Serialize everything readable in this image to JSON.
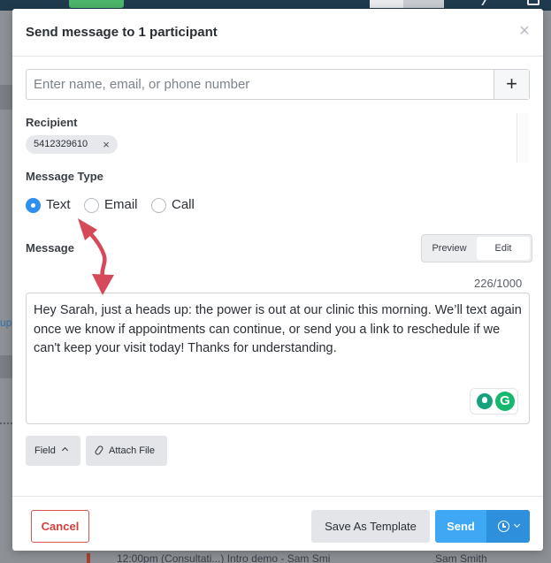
{
  "modal": {
    "title": "Send message to 1 participant",
    "close_glyph": "×"
  },
  "search": {
    "placeholder": "Enter name, email, or phone number",
    "value": "",
    "add_glyph": "+"
  },
  "recipient": {
    "label": "Recipient",
    "chips": [
      {
        "value": "5412329610",
        "remove_glyph": "×"
      }
    ]
  },
  "message_type": {
    "label": "Message Type",
    "options": [
      {
        "label": "Text",
        "checked": true
      },
      {
        "label": "Email",
        "checked": false
      },
      {
        "label": "Call",
        "checked": false
      }
    ]
  },
  "message": {
    "label": "Message",
    "mode_tabs": [
      {
        "label": "Preview",
        "active": false
      },
      {
        "label": "Edit",
        "active": true
      }
    ],
    "char_count": "226/1000",
    "body": "Hey Sarah, just a heads up: the power is out at our clinic this morning. We’ll text again once we know if appointments can continue, or send you a link to reschedule if we can't keep your visit today! Thanks for understanding.",
    "field_button": "Field",
    "attach_button": "Attach File"
  },
  "footer": {
    "cancel": "Cancel",
    "save_template": "Save As Template",
    "send": "Send"
  },
  "icons": {
    "close": "close-icon",
    "add": "plus-icon",
    "chip_remove": "close-icon",
    "field_caret": "chevron-up-icon",
    "attach": "paperclip-icon",
    "schedule": "clock-icon",
    "schedule_caret": "chevron-down-icon",
    "grammar_suggest": "lightbulb-icon",
    "grammarly": "grammarly-icon"
  },
  "background": {
    "bottom_row_text": "12:00pm  (Consultati...) Intro demo - Sam Smi",
    "bottom_row_right": "Sam Smith",
    "left_link": "up"
  },
  "colors": {
    "primary": "#3ea8f4",
    "primary_dark": "#2e8fdd",
    "danger": "#d43f3a",
    "radio_checked": "#2f8ff0",
    "annotation_arrow": "#d6495a",
    "grammarly_green": "#15b86e"
  }
}
